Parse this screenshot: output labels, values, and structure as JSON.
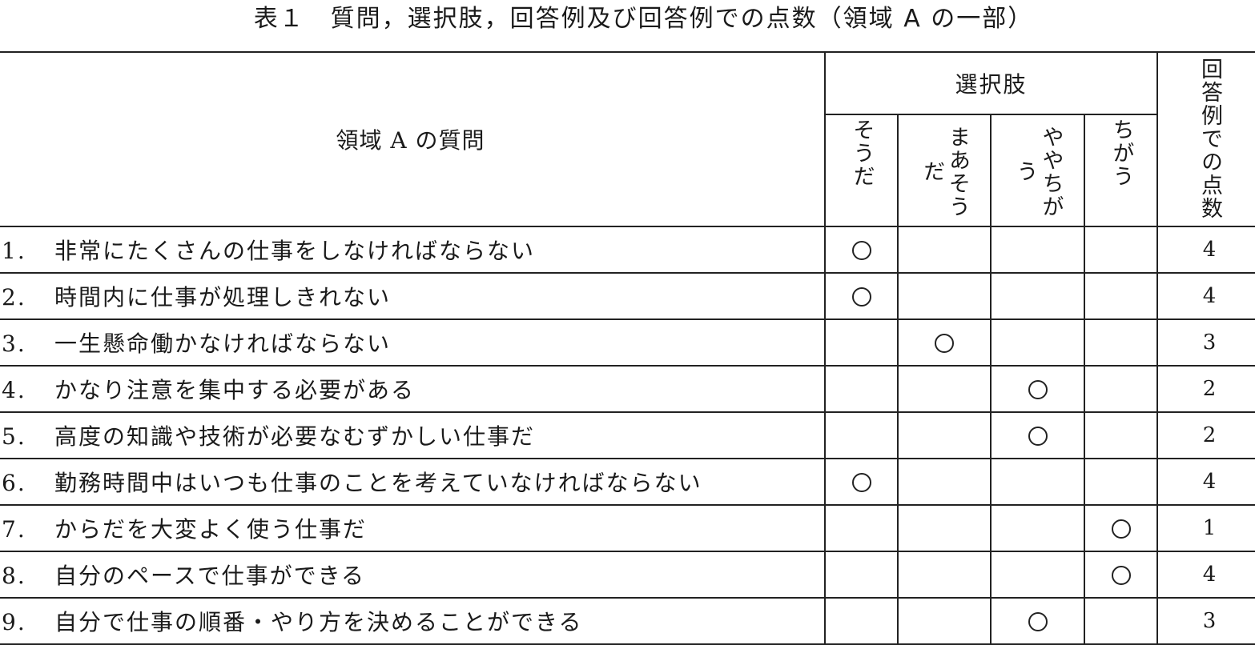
{
  "caption": "表１　質問，選択肢，回答例及び回答例での点数（領域 A の一部）",
  "header": {
    "question_col": "領域 A の質問",
    "choices_group": "選択肢",
    "choices": [
      "そうだ",
      "まあそうだ",
      "ややちがう",
      "ちがう"
    ],
    "score_col": "回答例での点数"
  },
  "rows": [
    {
      "num": "1.",
      "text": "非常にたくさんの仕事をしなければならない",
      "selected": 0,
      "score": "4"
    },
    {
      "num": "2.",
      "text": "時間内に仕事が処理しきれない",
      "selected": 0,
      "score": "4"
    },
    {
      "num": "3.",
      "text": "一生懸命働かなければならない",
      "selected": 1,
      "score": "3"
    },
    {
      "num": "4.",
      "text": "かなり注意を集中する必要がある",
      "selected": 2,
      "score": "2"
    },
    {
      "num": "5.",
      "text": "高度の知識や技術が必要なむずかしい仕事だ",
      "selected": 2,
      "score": "2"
    },
    {
      "num": "6.",
      "text": "勤務時間中はいつも仕事のことを考えていなければならない",
      "selected": 0,
      "score": "4"
    },
    {
      "num": "7.",
      "text": "からだを大変よく使う仕事だ",
      "selected": 3,
      "score": "1"
    },
    {
      "num": "8.",
      "text": "自分のペースで仕事ができる",
      "selected": 3,
      "score": "4"
    },
    {
      "num": "9.",
      "text": "自分で仕事の順番・やり方を決めることができる",
      "selected": 2,
      "score": "3"
    }
  ],
  "mark_symbol": "○"
}
